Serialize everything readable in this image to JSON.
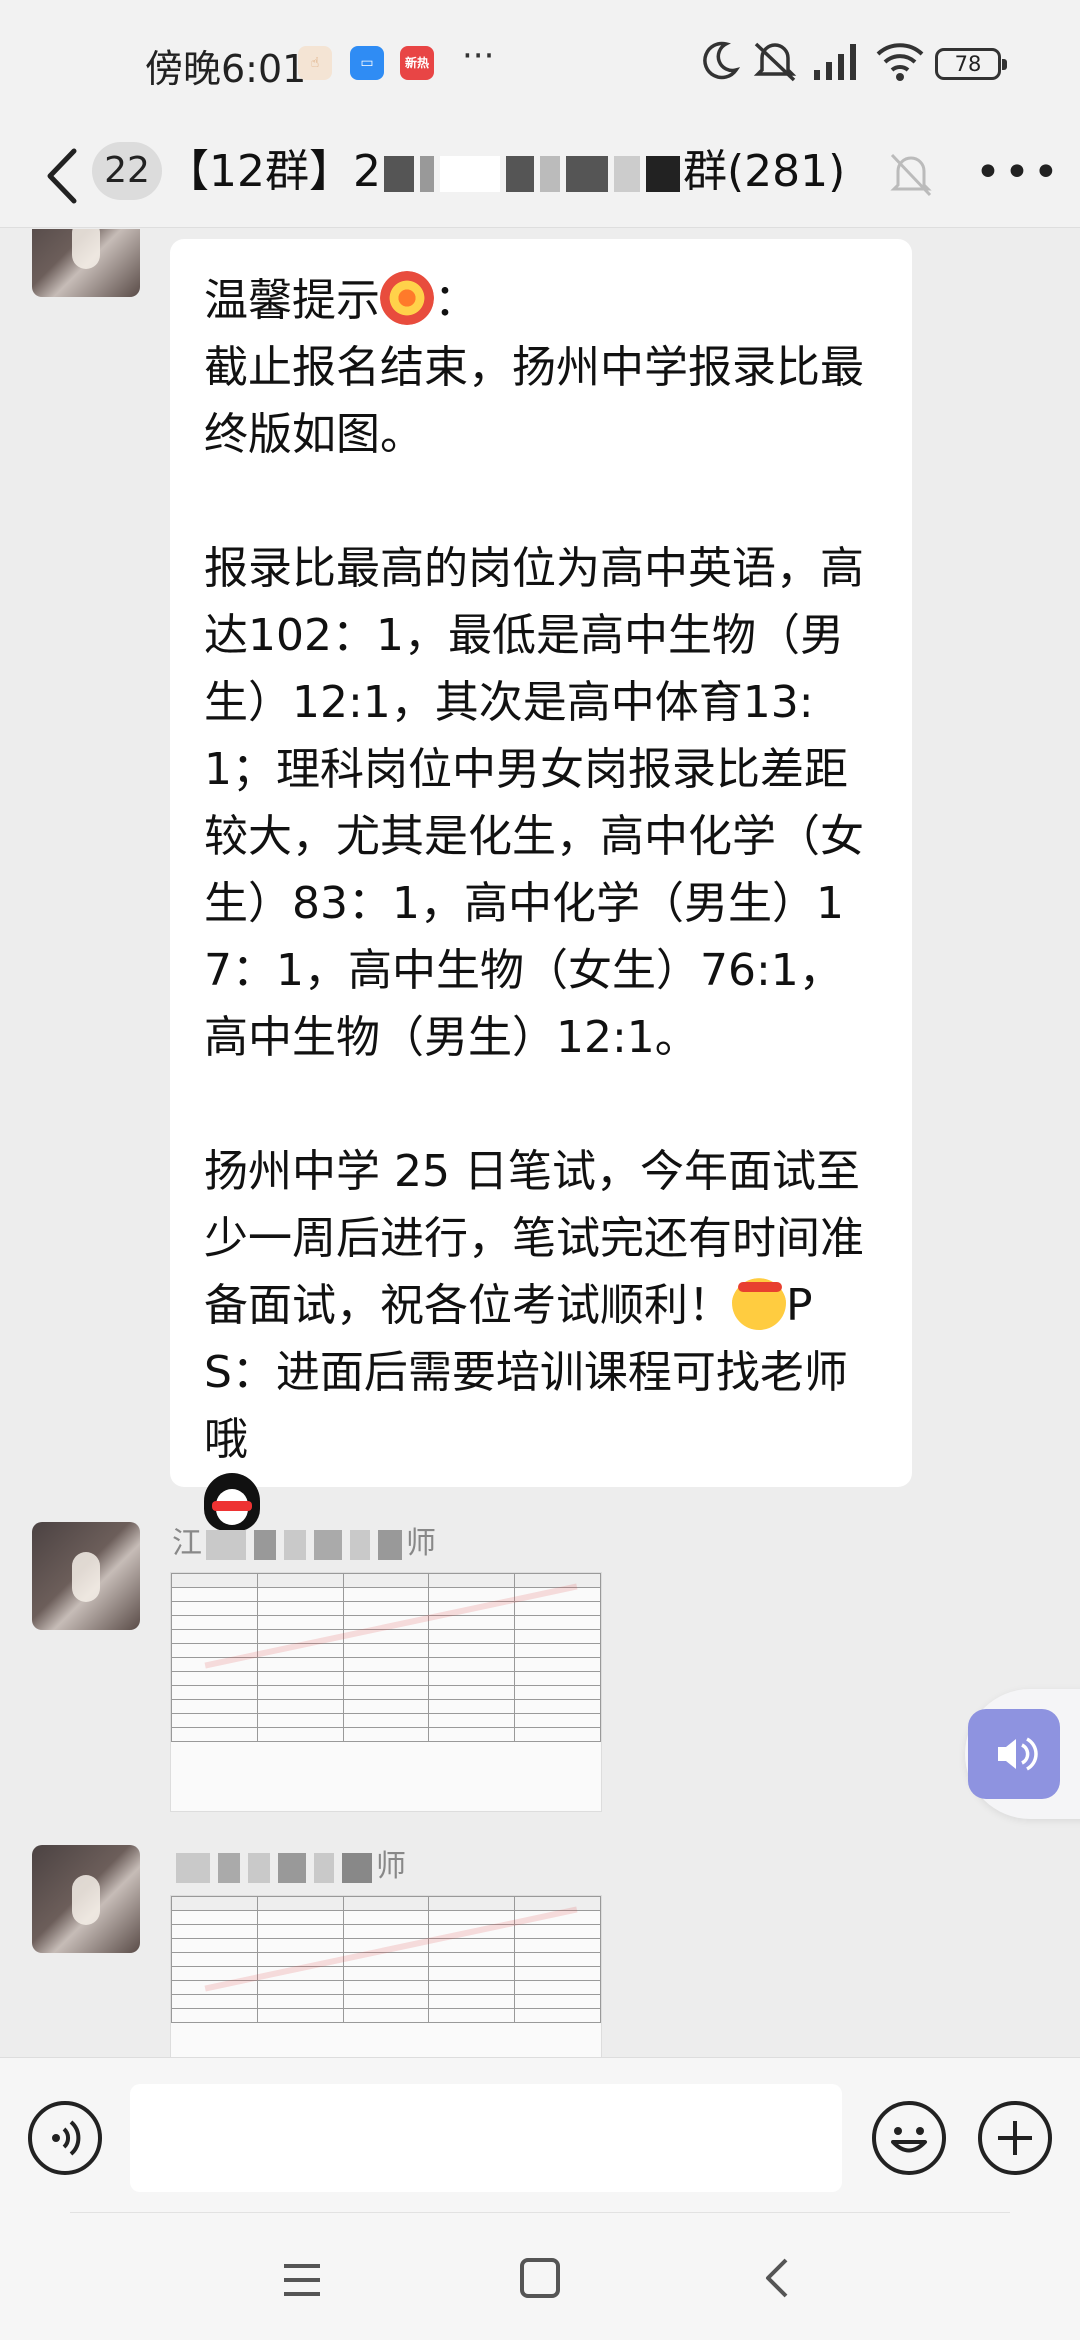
{
  "status_bar": {
    "time": "傍晚6:01",
    "notification_app_badge": "新热",
    "more": "···",
    "battery": "78"
  },
  "header": {
    "unread_count": "22",
    "group_title_prefix": "【12群】2",
    "group_title_suffix": "群(281)"
  },
  "messages": [
    {
      "type": "text",
      "paragraphs": [
        "温馨提示",
        "：\n截止报名结束，扬州中学报录比最终版如图。",
        "报录比最高的岗位为高中英语，高达102：1，最低是高中生物（男生）12:1，其次是高中体育13:1；理科岗位中男女岗报录比差距较大，尤其是化生，高中化学（女生）83：1，高中化学（男生）17：1，高中生物（女生）76:1，高中生物（男生）12:1。",
        "扬州中学 25 日笔试，今年面试至少一周后进行，笔试完还有时间准备面试，祝各位考试顺利！",
        "PS：进面后需要培训课程可找老师哦"
      ]
    },
    {
      "type": "image",
      "sender_first": "江",
      "sender_last": "师"
    },
    {
      "type": "image",
      "sender_first": "",
      "sender_last": "师"
    }
  ],
  "input": {
    "value": ""
  },
  "icons": {
    "back": "chevron-left-icon",
    "bell": "bell-muted-icon",
    "menu": "more-icon",
    "voice": "voice-icon",
    "emoji": "emoji-icon",
    "plus": "plus-icon",
    "float": "speaker-icon"
  },
  "colors": {
    "background": "#ededed",
    "bubble": "#ffffff",
    "float_button": "#8e93e0"
  }
}
